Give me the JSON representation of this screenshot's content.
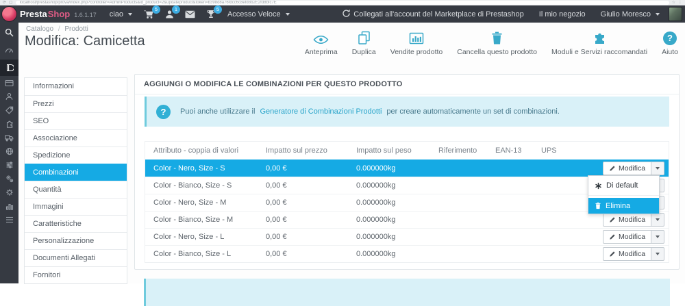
{
  "browser": {
    "url": "localhost/prestashop/prova/index.php?controller=AdminProducts&id_product=2&updateproduct&token=b398d8a76fdcc6c8efd8b2E2fd8bfc7E"
  },
  "topbar": {
    "brand_presta": "Presta",
    "brand_shop": "Shop",
    "version": "1.6.1.17",
    "shop_menu": "ciao",
    "cart_badge": "5",
    "customers_badge": "1",
    "trophy_badge": "5",
    "quick_access": "Accesso Veloce",
    "marketplace_link": "Collegati all'account del Marketplace di Prestashop",
    "my_shop": "Il mio negozio",
    "user_name": "Giulio Moresco"
  },
  "sidebar": {
    "icons": [
      "search",
      "dashboard",
      "catalog",
      "orders",
      "customers",
      "price-rules",
      "modules",
      "shipping",
      "localization",
      "preferences",
      "advanced-parameters",
      "administration",
      "stats",
      "menu"
    ]
  },
  "page": {
    "breadcrumb_section": "Catalogo",
    "breadcrumb_sep": "/",
    "breadcrumb_page": "Prodotti",
    "title": "Modifica: Camicetta"
  },
  "actions": [
    {
      "name": "preview",
      "label": "Anteprima"
    },
    {
      "name": "duplicate",
      "label": "Duplica"
    },
    {
      "name": "product-sales",
      "label": "Vendite prodotto"
    },
    {
      "name": "delete-product",
      "label": "Cancella questo prodotto"
    },
    {
      "name": "recommended-modules",
      "label": "Moduli e Servizi raccomandati"
    },
    {
      "name": "help",
      "label": "Aiuto"
    }
  ],
  "tabs": {
    "items": [
      "Informazioni",
      "Prezzi",
      "SEO",
      "Associazione",
      "Spedizione",
      "Combinazioni",
      "Quantità",
      "Immagini",
      "Caratteristiche",
      "Personalizzazione",
      "Documenti Allegati",
      "Fornitori"
    ],
    "active": "Combinazioni"
  },
  "panel": {
    "heading": "AGGIUNGI O MODIFICA LE COMBINAZIONI PER QUESTO PRODOTTO",
    "alert": {
      "text_before": "Puoi anche utilizzare il",
      "link": "Generatore di Combinazioni Prodotti",
      "text_after": "per creare automaticamente un set di combinazioni."
    },
    "table": {
      "headers": [
        "Attributo - coppia di valori",
        "Impatto sul prezzo",
        "Impatto sul peso",
        "Riferimento",
        "EAN-13",
        "UPS"
      ],
      "edit_label": "Modifica",
      "rows": [
        {
          "combination": "Color - Nero, Size - S",
          "price": "0,00 €",
          "weight": "0.000000kg",
          "reference": "",
          "ean13": "",
          "ups": ""
        },
        {
          "combination": "Color - Bianco, Size - S",
          "price": "0,00 €",
          "weight": "0.000000kg",
          "reference": "",
          "ean13": "",
          "ups": ""
        },
        {
          "combination": "Color - Nero, Size - M",
          "price": "0,00 €",
          "weight": "0.000000kg",
          "reference": "",
          "ean13": "",
          "ups": ""
        },
        {
          "combination": "Color - Bianco, Size - M",
          "price": "0,00 €",
          "weight": "0.000000kg",
          "reference": "",
          "ean13": "",
          "ups": ""
        },
        {
          "combination": "Color - Nero, Size - L",
          "price": "0,00 €",
          "weight": "0.000000kg",
          "reference": "",
          "ean13": "",
          "ups": ""
        },
        {
          "combination": "Color - Bianco, Size - L",
          "price": "0,00 €",
          "weight": "0.000000kg",
          "reference": "",
          "ean13": "",
          "ups": ""
        }
      ]
    },
    "dropdown": {
      "default_label": "Di default",
      "delete_label": "Elimina"
    }
  },
  "colors": {
    "accent": "#15aae4",
    "topbar_bg": "#363a42",
    "action_icon_teal": "#38a9c9",
    "alert_bg": "#d9f1f8",
    "alert_border": "#6fcbdd",
    "brand_pink": "#e05c86"
  }
}
